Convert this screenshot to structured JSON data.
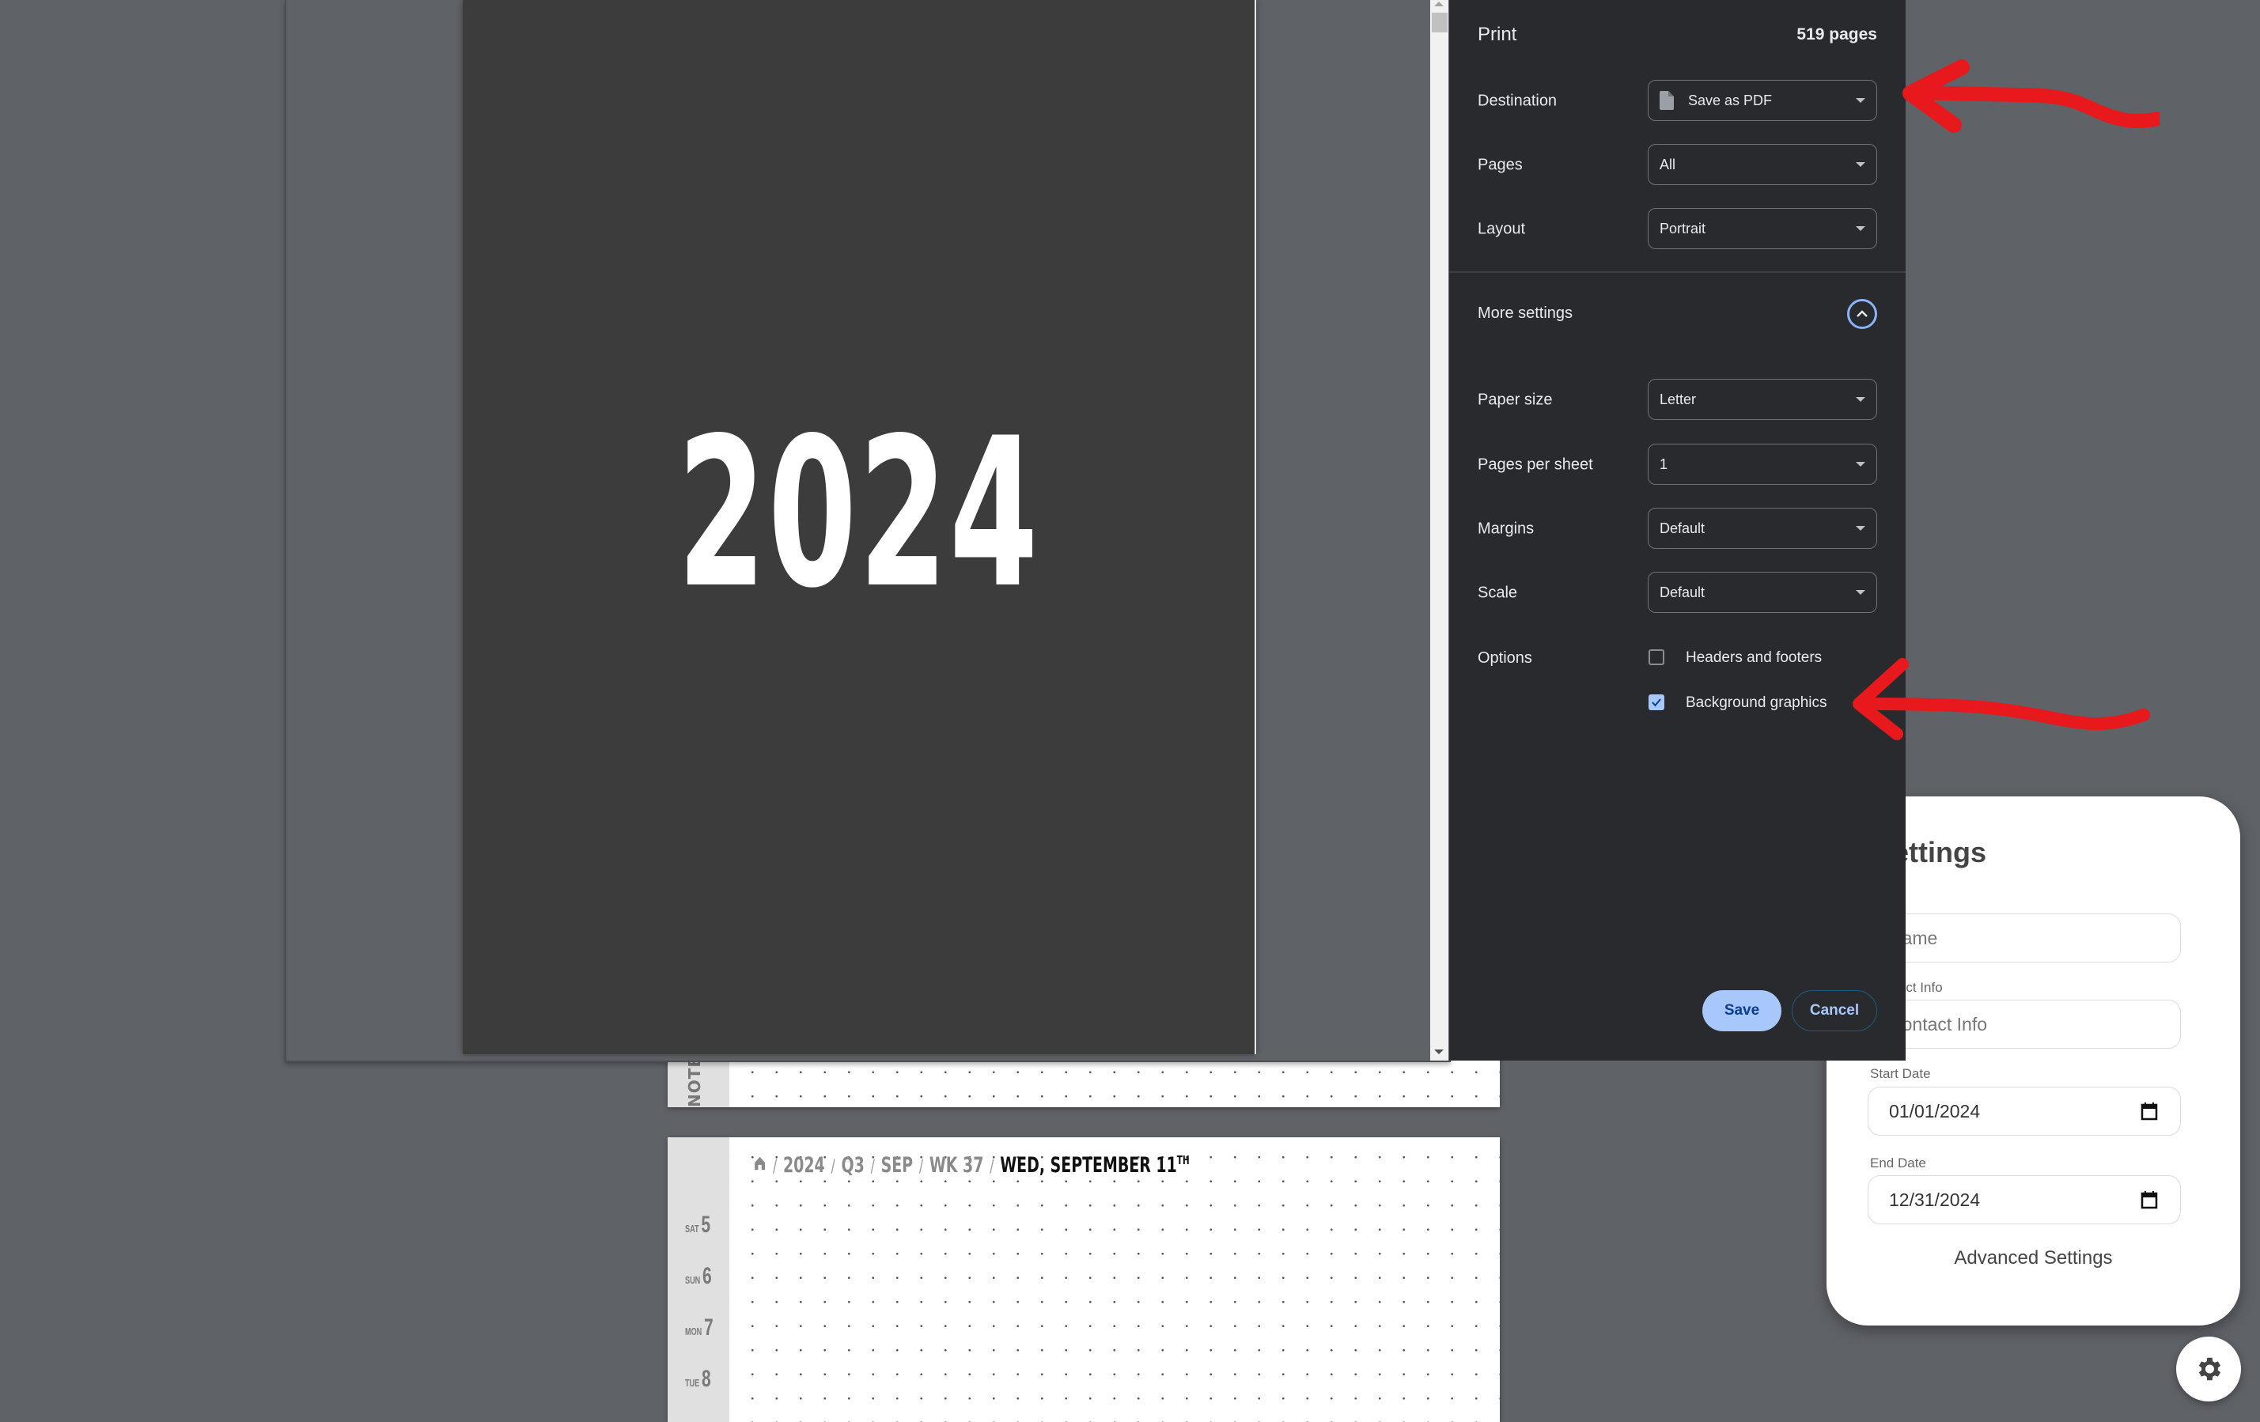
{
  "planner": {
    "notes_label": "NOTES",
    "breadcrumb": {
      "home_icon": "home-icon",
      "items": [
        "2024",
        "Q3",
        "SEP",
        "WK 37"
      ],
      "separator": "/",
      "current": "WED, SEPTEMBER 11",
      "current_suffix": "TH"
    },
    "days": [
      {
        "weekday": "SAT",
        "day": "5"
      },
      {
        "weekday": "SUN",
        "day": "6"
      },
      {
        "weekday": "MON",
        "day": "7"
      },
      {
        "weekday": "TUE",
        "day": "8"
      }
    ]
  },
  "preview": {
    "cover_year": "2024"
  },
  "print_dialog": {
    "title": "Print",
    "page_count": "519 pages",
    "destination": {
      "label": "Destination",
      "value": "Save as PDF",
      "icon": "file-icon"
    },
    "pages": {
      "label": "Pages",
      "value": "All"
    },
    "layout": {
      "label": "Layout",
      "value": "Portrait"
    },
    "more_settings": {
      "label": "More settings",
      "expanded": true,
      "icon": "chevron-up-icon"
    },
    "paper_size": {
      "label": "Paper size",
      "value": "Letter"
    },
    "pages_per_sheet": {
      "label": "Pages per sheet",
      "value": "1"
    },
    "margins": {
      "label": "Margins",
      "value": "Default"
    },
    "scale": {
      "label": "Scale",
      "value": "Default"
    },
    "options": {
      "label": "Options",
      "headers_footers": {
        "label": "Headers and footers",
        "checked": false
      },
      "background_graphics": {
        "label": "Background graphics",
        "checked": true
      }
    },
    "save_label": "Save",
    "cancel_label": "Cancel",
    "accent_color": "#a8c7fa",
    "background_color": "#292a2d"
  },
  "settings_panel": {
    "title": "Settings",
    "name": {
      "label": "Name",
      "placeholder": "Name"
    },
    "contact": {
      "label": "Contact Info",
      "placeholder": "Contact Info"
    },
    "start_date": {
      "label": "Start Date",
      "value": "01/01/2024"
    },
    "end_date": {
      "label": "End Date",
      "value": "12/31/2024"
    },
    "advanced_label": "Advanced Settings",
    "gear_icon": "gear-icon"
  },
  "annotations": {
    "arrow_color": "#e8191c",
    "targets": [
      "destination",
      "background-graphics"
    ]
  }
}
